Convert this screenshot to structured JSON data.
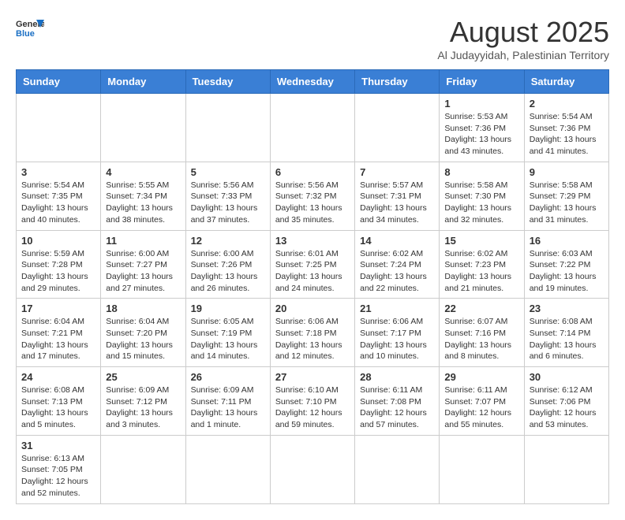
{
  "logo": {
    "general": "General",
    "blue": "Blue"
  },
  "header": {
    "title": "August 2025",
    "subtitle": "Al Judayyidah, Palestinian Territory"
  },
  "weekdays": [
    "Sunday",
    "Monday",
    "Tuesday",
    "Wednesday",
    "Thursday",
    "Friday",
    "Saturday"
  ],
  "days": [
    {
      "date": "",
      "info": ""
    },
    {
      "date": "",
      "info": ""
    },
    {
      "date": "",
      "info": ""
    },
    {
      "date": "",
      "info": ""
    },
    {
      "date": "",
      "info": ""
    },
    {
      "date": "1",
      "info": "Sunrise: 5:53 AM\nSunset: 7:36 PM\nDaylight: 13 hours and 43 minutes."
    },
    {
      "date": "2",
      "info": "Sunrise: 5:54 AM\nSunset: 7:36 PM\nDaylight: 13 hours and 41 minutes."
    },
    {
      "date": "3",
      "info": "Sunrise: 5:54 AM\nSunset: 7:35 PM\nDaylight: 13 hours and 40 minutes."
    },
    {
      "date": "4",
      "info": "Sunrise: 5:55 AM\nSunset: 7:34 PM\nDaylight: 13 hours and 38 minutes."
    },
    {
      "date": "5",
      "info": "Sunrise: 5:56 AM\nSunset: 7:33 PM\nDaylight: 13 hours and 37 minutes."
    },
    {
      "date": "6",
      "info": "Sunrise: 5:56 AM\nSunset: 7:32 PM\nDaylight: 13 hours and 35 minutes."
    },
    {
      "date": "7",
      "info": "Sunrise: 5:57 AM\nSunset: 7:31 PM\nDaylight: 13 hours and 34 minutes."
    },
    {
      "date": "8",
      "info": "Sunrise: 5:58 AM\nSunset: 7:30 PM\nDaylight: 13 hours and 32 minutes."
    },
    {
      "date": "9",
      "info": "Sunrise: 5:58 AM\nSunset: 7:29 PM\nDaylight: 13 hours and 31 minutes."
    },
    {
      "date": "10",
      "info": "Sunrise: 5:59 AM\nSunset: 7:28 PM\nDaylight: 13 hours and 29 minutes."
    },
    {
      "date": "11",
      "info": "Sunrise: 6:00 AM\nSunset: 7:27 PM\nDaylight: 13 hours and 27 minutes."
    },
    {
      "date": "12",
      "info": "Sunrise: 6:00 AM\nSunset: 7:26 PM\nDaylight: 13 hours and 26 minutes."
    },
    {
      "date": "13",
      "info": "Sunrise: 6:01 AM\nSunset: 7:25 PM\nDaylight: 13 hours and 24 minutes."
    },
    {
      "date": "14",
      "info": "Sunrise: 6:02 AM\nSunset: 7:24 PM\nDaylight: 13 hours and 22 minutes."
    },
    {
      "date": "15",
      "info": "Sunrise: 6:02 AM\nSunset: 7:23 PM\nDaylight: 13 hours and 21 minutes."
    },
    {
      "date": "16",
      "info": "Sunrise: 6:03 AM\nSunset: 7:22 PM\nDaylight: 13 hours and 19 minutes."
    },
    {
      "date": "17",
      "info": "Sunrise: 6:04 AM\nSunset: 7:21 PM\nDaylight: 13 hours and 17 minutes."
    },
    {
      "date": "18",
      "info": "Sunrise: 6:04 AM\nSunset: 7:20 PM\nDaylight: 13 hours and 15 minutes."
    },
    {
      "date": "19",
      "info": "Sunrise: 6:05 AM\nSunset: 7:19 PM\nDaylight: 13 hours and 14 minutes."
    },
    {
      "date": "20",
      "info": "Sunrise: 6:06 AM\nSunset: 7:18 PM\nDaylight: 13 hours and 12 minutes."
    },
    {
      "date": "21",
      "info": "Sunrise: 6:06 AM\nSunset: 7:17 PM\nDaylight: 13 hours and 10 minutes."
    },
    {
      "date": "22",
      "info": "Sunrise: 6:07 AM\nSunset: 7:16 PM\nDaylight: 13 hours and 8 minutes."
    },
    {
      "date": "23",
      "info": "Sunrise: 6:08 AM\nSunset: 7:14 PM\nDaylight: 13 hours and 6 minutes."
    },
    {
      "date": "24",
      "info": "Sunrise: 6:08 AM\nSunset: 7:13 PM\nDaylight: 13 hours and 5 minutes."
    },
    {
      "date": "25",
      "info": "Sunrise: 6:09 AM\nSunset: 7:12 PM\nDaylight: 13 hours and 3 minutes."
    },
    {
      "date": "26",
      "info": "Sunrise: 6:09 AM\nSunset: 7:11 PM\nDaylight: 13 hours and 1 minute."
    },
    {
      "date": "27",
      "info": "Sunrise: 6:10 AM\nSunset: 7:10 PM\nDaylight: 12 hours and 59 minutes."
    },
    {
      "date": "28",
      "info": "Sunrise: 6:11 AM\nSunset: 7:08 PM\nDaylight: 12 hours and 57 minutes."
    },
    {
      "date": "29",
      "info": "Sunrise: 6:11 AM\nSunset: 7:07 PM\nDaylight: 12 hours and 55 minutes."
    },
    {
      "date": "30",
      "info": "Sunrise: 6:12 AM\nSunset: 7:06 PM\nDaylight: 12 hours and 53 minutes."
    },
    {
      "date": "31",
      "info": "Sunrise: 6:13 AM\nSunset: 7:05 PM\nDaylight: 12 hours and 52 minutes."
    }
  ]
}
